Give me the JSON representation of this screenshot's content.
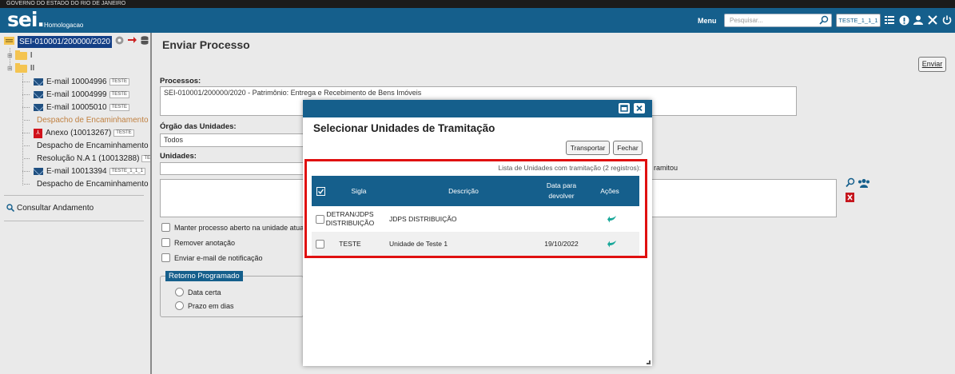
{
  "header": {
    "gov_banner": "GOVERNO DO ESTADO DO RIO DE JANEIRO",
    "logo_text": "sei.",
    "environment": "Homologacao",
    "menu_label": "Menu",
    "search_placeholder": "Pesquisar...",
    "unit_badge": "TESTE_1_1_1",
    "icons": [
      "menu-grid-icon",
      "info-icon",
      "user-icon",
      "tools-icon",
      "power-icon"
    ]
  },
  "tree": {
    "process": "SEI-010001/200000/2020",
    "folders": [
      "I",
      "II"
    ],
    "items": [
      {
        "label": "E-mail 10004996",
        "tag": "TESTE",
        "icon": "email-icon"
      },
      {
        "label": "E-mail 10004999",
        "tag": "TESTE",
        "icon": "email-icon"
      },
      {
        "label": "E-mail 10005010",
        "tag": "TESTE",
        "icon": "email-icon"
      },
      {
        "label": "Despacho de Encaminhamento d",
        "tag": "",
        "icon": "document-icon"
      },
      {
        "label": "Anexo (10013267)",
        "tag": "TESTE",
        "icon": "pdf-icon"
      },
      {
        "label": "Despacho de Encaminhamento d",
        "tag": "",
        "icon": "document-icon"
      },
      {
        "label": "Resolução N.A 1 (10013288)",
        "tag": "TES",
        "icon": "document-icon"
      },
      {
        "label": "E-mail 10013394",
        "tag": "TESTE_1_1_1",
        "icon": "email-icon"
      },
      {
        "label": "Despacho de Encaminhamento d",
        "tag": "",
        "icon": "document-icon"
      }
    ],
    "consult_label": "Consultar Andamento"
  },
  "form": {
    "title": "Enviar Processo",
    "send_button": "Enviar",
    "processos_label": "Processos:",
    "processos_value": "SEI-010001/200000/2020 - Patrimônio: Entrega e Recebimento de Bens Imóveis",
    "orgao_label": "Órgão das Unidades:",
    "orgao_value": "Todos",
    "unidades_label": "Unidades:",
    "unidades_suffix": "ramitou",
    "checkboxes": [
      "Manter processo aberto na unidade atual",
      "Remover anotação",
      "Enviar e-mail de notificação"
    ],
    "retorno_legend": "Retorno Programado",
    "radios": [
      "Data certa",
      "Prazo em dias"
    ]
  },
  "modal": {
    "title": "Selecionar Unidades de Tramitação",
    "transport_button": "Transportar",
    "close_button": "Fechar",
    "caption": "Lista de Unidades com tramitação (2 registros):",
    "columns": [
      "Sigla",
      "Descrição",
      "Data para devolver",
      "Ações"
    ],
    "rows": [
      {
        "sigla": "DETRAN/JDPS DISTRIBUIÇÃO",
        "descricao": "JDPS DISTRIBUIÇÃO",
        "data": ""
      },
      {
        "sigla": "TESTE",
        "descricao": "Unidade de Teste 1",
        "data": "19/10/2022"
      }
    ]
  },
  "colors": {
    "brand": "#155f8c",
    "selection": "#143f86",
    "highlight": "#e01010",
    "action": "#1aa89a"
  }
}
